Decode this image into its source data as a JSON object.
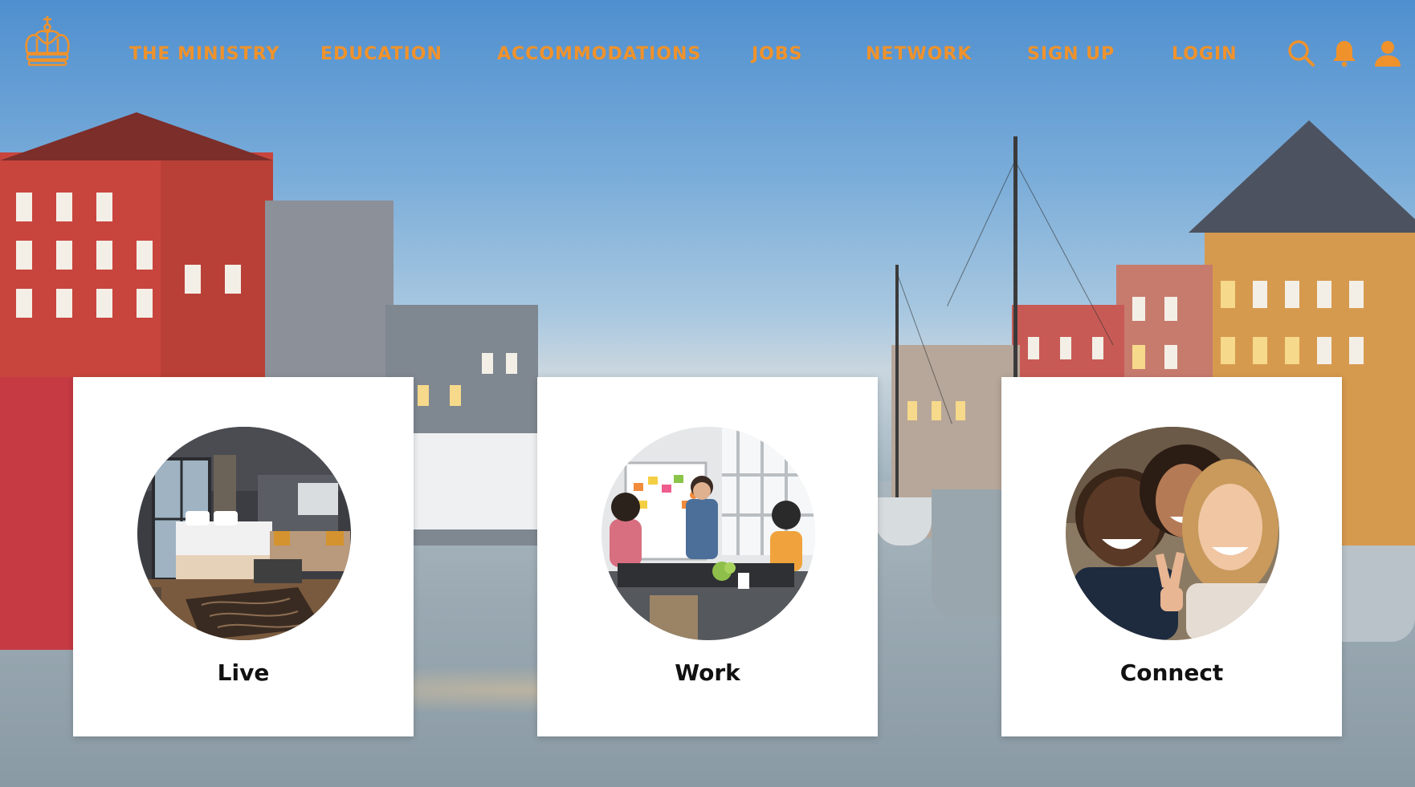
{
  "nav": {
    "logo_icon": "crown-icon",
    "links": [
      {
        "label": "THE MINISTRY"
      },
      {
        "label": "EDUCATION"
      },
      {
        "label": "ACCOMMODATIONS"
      },
      {
        "label": "JOBS"
      },
      {
        "label": "NETWORK"
      },
      {
        "label": "SIGN UP"
      },
      {
        "label": "LOGIN"
      }
    ],
    "icons": [
      "search-icon",
      "bell-icon",
      "user-icon"
    ],
    "accent_color": "#f0922b"
  },
  "cards": [
    {
      "label": "Live",
      "image": "hotel-room-photo"
    },
    {
      "label": "Work",
      "image": "team-meeting-photo"
    },
    {
      "label": "Connect",
      "image": "friends-selfie-photo"
    }
  ]
}
